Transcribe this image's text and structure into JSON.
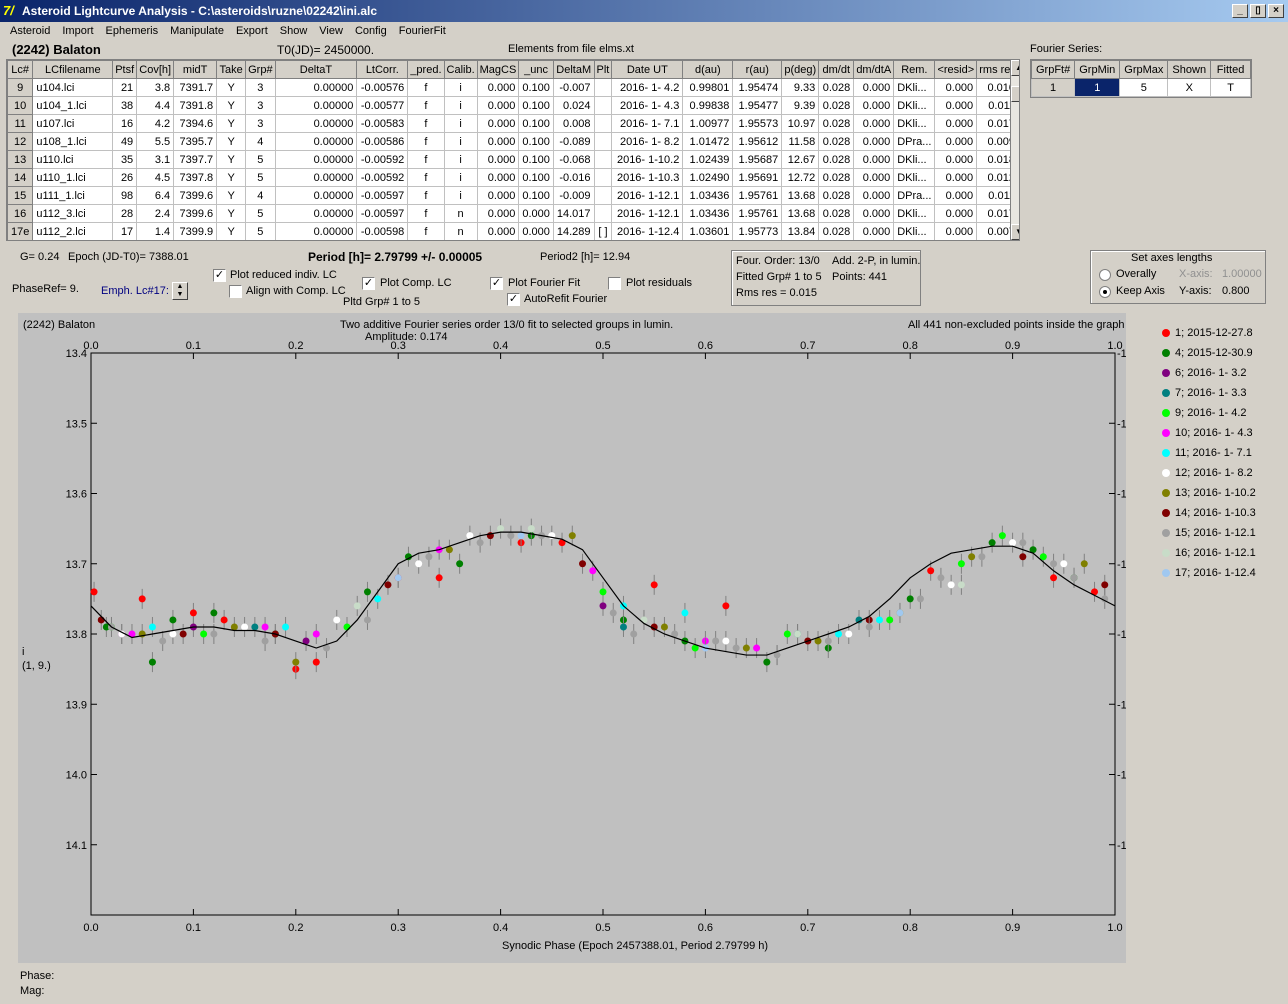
{
  "window": {
    "title": "Asteroid Lightcurve Analysis - C:\\asteroids\\ruzne\\02242\\ini.alc",
    "icon": "7/",
    "min": "_",
    "max": "▯",
    "close": "×"
  },
  "menu": [
    "Asteroid",
    "Import",
    "Ephemeris",
    "Manipulate",
    "Export",
    "Show",
    "View",
    "Config",
    "FourierFit"
  ],
  "header": {
    "asteroid": "(2242) Balaton",
    "t0": "T0(JD)= 2450000.",
    "elements": "Elements from file elms.xt"
  },
  "table": {
    "columns": [
      "Lc#",
      "LCfilename",
      "Ptsf",
      "Cov[h]",
      "midT",
      "Take",
      "Grp#",
      "DeltaT",
      "LtCorr.",
      "_pred.",
      "Calib.",
      "MagCS",
      "_unc",
      "DeltaM",
      "Plt",
      "Date UT",
      "d(au)",
      "r(au)",
      "p(deg)",
      "dm/dt",
      "dm/dtA",
      "Rem.",
      "<resid>",
      "rms res"
    ],
    "rows": [
      [
        "9",
        "u104.lci",
        "21",
        "3.8",
        "7391.7",
        "Y",
        "3",
        "0.00000",
        "-0.00576",
        "f",
        "i",
        "0.000",
        "0.100",
        "-0.007",
        "",
        "2016- 1- 4.2",
        "0.99801",
        "1.95474",
        "9.33",
        "0.028",
        "0.000",
        "DKli...",
        "0.000",
        "0.010"
      ],
      [
        "10",
        "u104_1.lci",
        "38",
        "4.4",
        "7391.8",
        "Y",
        "3",
        "0.00000",
        "-0.00577",
        "f",
        "i",
        "0.000",
        "0.100",
        "0.024",
        "",
        "2016- 1- 4.3",
        "0.99838",
        "1.95477",
        "9.39",
        "0.028",
        "0.000",
        "DKli...",
        "0.000",
        "0.011"
      ],
      [
        "11",
        "u107.lci",
        "16",
        "4.2",
        "7394.6",
        "Y",
        "3",
        "0.00000",
        "-0.00583",
        "f",
        "i",
        "0.000",
        "0.100",
        "0.008",
        "",
        "2016- 1- 7.1",
        "1.00977",
        "1.95573",
        "10.97",
        "0.028",
        "0.000",
        "DKli...",
        "0.000",
        "0.017"
      ],
      [
        "12",
        "u108_1.lci",
        "49",
        "5.5",
        "7395.7",
        "Y",
        "4",
        "0.00000",
        "-0.00586",
        "f",
        "i",
        "0.000",
        "0.100",
        "-0.089",
        "",
        "2016- 1- 8.2",
        "1.01472",
        "1.95612",
        "11.58",
        "0.028",
        "0.000",
        "DPra...",
        "0.000",
        "0.009"
      ],
      [
        "13",
        "u110.lci",
        "35",
        "3.1",
        "7397.7",
        "Y",
        "5",
        "0.00000",
        "-0.00592",
        "f",
        "i",
        "0.000",
        "0.100",
        "-0.068",
        "",
        "2016- 1-10.2",
        "1.02439",
        "1.95687",
        "12.67",
        "0.028",
        "0.000",
        "DKli...",
        "0.000",
        "0.018"
      ],
      [
        "14",
        "u110_1.lci",
        "26",
        "4.5",
        "7397.8",
        "Y",
        "5",
        "0.00000",
        "-0.00592",
        "f",
        "i",
        "0.000",
        "0.100",
        "-0.016",
        "",
        "2016- 1-10.3",
        "1.02490",
        "1.95691",
        "12.72",
        "0.028",
        "0.000",
        "DKli...",
        "0.000",
        "0.012"
      ],
      [
        "15",
        "u111_1.lci",
        "98",
        "6.4",
        "7399.6",
        "Y",
        "4",
        "0.00000",
        "-0.00597",
        "f",
        "i",
        "0.000",
        "0.100",
        "-0.009",
        "",
        "2016- 1-12.1",
        "1.03436",
        "1.95761",
        "13.68",
        "0.028",
        "0.000",
        "DPra...",
        "0.000",
        "0.011"
      ],
      [
        "16",
        "u112_3.lci",
        "28",
        "2.4",
        "7399.6",
        "Y",
        "5",
        "0.00000",
        "-0.00597",
        "f",
        "n",
        "0.000",
        "0.000",
        "14.017",
        "",
        "2016- 1-12.1",
        "1.03436",
        "1.95761",
        "13.68",
        "0.028",
        "0.000",
        "DKli...",
        "0.000",
        "0.017"
      ],
      [
        "17e",
        "u112_2.lci",
        "17",
        "1.4",
        "7399.9",
        "Y",
        "5",
        "0.00000",
        "-0.00598",
        "f",
        "n",
        "0.000",
        "0.000",
        "14.289",
        "[ ]",
        "2016- 1-12.4",
        "1.03601",
        "1.95773",
        "13.84",
        "0.028",
        "0.000",
        "DKli...",
        "0.000",
        "0.007"
      ]
    ]
  },
  "fourier": {
    "label": "Fourier Series:",
    "columns": [
      "GrpFt#",
      "GrpMin",
      "GrpMax",
      "Shown",
      "Fitted"
    ],
    "row": [
      "1",
      "1",
      "5",
      "X",
      "T"
    ]
  },
  "controls": {
    "g": "G= 0.24",
    "epoch": "Epoch (JD-T0)= 7388.01",
    "period": "Period [h]= 2.79799 +/- 0.00005",
    "period2": "Period2 [h]= 12.94",
    "phaseref": "PhaseRef= 9.",
    "emph": "Emph. Lc#17:",
    "plot_reduced": "Plot reduced indiv. LC",
    "align_comp": "Align with Comp. LC",
    "plot_comp": "Plot Comp. LC",
    "pltd_grp": "Pltd Grp#  1   to   5",
    "plot_fourier": "Plot Fourier Fit",
    "autorefit": "AutoRefit Fourier",
    "plot_residuals": "Plot residuals",
    "check": "✓",
    "four_order": "Four. Order: 13/0",
    "add": "Add. 2-P, in lumin.",
    "fitted_grp": "Fitted Grp# 1 to 5",
    "points": "Points: 441",
    "rms": "Rms res     = 0.015",
    "axes_title": "Set axes lengths",
    "overally": "Overally",
    "keep_axis": "Keep Axis",
    "xaxis_lbl": "X-axis:",
    "xaxis_val": "1.00000",
    "yaxis_lbl": "Y-axis:",
    "yaxis_val": "0.800"
  },
  "plot": {
    "asteroid": "(2242) Balaton",
    "title": "Two additive Fourier series order 13/0 fit to selected groups in lumin.",
    "amplitude": "Amplitude: 0.174",
    "note": "All 441 non-excluded points inside the graph",
    "ylabel": "i",
    "ylabel2": "(1, 9.)",
    "xlabel": "Synodic Phase (Epoch 2457388.01, Period 2.79799 h)"
  },
  "chart_data": {
    "type": "scatter",
    "xlabel": "Synodic Phase (Epoch 2457388.01, Period 2.79799 h)",
    "ylabel": "i",
    "xlim": [
      0,
      1
    ],
    "ylim": [
      14.2,
      13.4
    ],
    "y_inverted": true,
    "xticks": [
      "0.0",
      "0.1",
      "0.2",
      "0.3",
      "0.4",
      "0.5",
      "0.6",
      "0.7",
      "0.8",
      "0.9",
      "1.0"
    ],
    "yticks": [
      "13.4",
      "13.5",
      "13.6",
      "13.7",
      "13.8",
      "13.9",
      "14.0",
      "14.1"
    ],
    "fit_curve": {
      "x": [
        0,
        0.02,
        0.04,
        0.06,
        0.08,
        0.1,
        0.12,
        0.14,
        0.16,
        0.18,
        0.2,
        0.22,
        0.24,
        0.26,
        0.28,
        0.3,
        0.32,
        0.34,
        0.36,
        0.38,
        0.4,
        0.42,
        0.44,
        0.46,
        0.48,
        0.5,
        0.52,
        0.54,
        0.56,
        0.58,
        0.6,
        0.62,
        0.64,
        0.66,
        0.68,
        0.7,
        0.72,
        0.74,
        0.76,
        0.78,
        0.8,
        0.82,
        0.84,
        0.86,
        0.88,
        0.9,
        0.92,
        0.94,
        0.96,
        0.98,
        1.0
      ],
      "y": [
        13.76,
        13.79,
        13.805,
        13.8,
        13.795,
        13.79,
        13.79,
        13.795,
        13.795,
        13.8,
        13.81,
        13.82,
        13.81,
        13.78,
        13.74,
        13.7,
        13.685,
        13.68,
        13.67,
        13.66,
        13.655,
        13.655,
        13.66,
        13.665,
        13.68,
        13.72,
        13.76,
        13.785,
        13.8,
        13.81,
        13.82,
        13.825,
        13.83,
        13.83,
        13.82,
        13.81,
        13.8,
        13.79,
        13.775,
        13.75,
        13.72,
        13.7,
        13.685,
        13.68,
        13.675,
        13.675,
        13.685,
        13.71,
        13.73,
        13.745,
        13.76
      ]
    },
    "series": [
      {
        "name": "1; 2015-12-27.8",
        "color": "#ff0000",
        "x": [
          0.003,
          0.05,
          0.1,
          0.13,
          0.2,
          0.22,
          0.3,
          0.34,
          0.42,
          0.46,
          0.55,
          0.62,
          0.82,
          0.94,
          0.98
        ],
        "y": [
          13.74,
          13.75,
          13.77,
          13.78,
          13.85,
          13.84,
          13.72,
          13.72,
          13.67,
          13.67,
          13.73,
          13.76,
          13.71,
          13.72,
          13.74
        ]
      },
      {
        "name": "4; 2015-12-30.9",
        "color": "#008000",
        "x": [
          0.015,
          0.06,
          0.08,
          0.12,
          0.18,
          0.27,
          0.31,
          0.36,
          0.43,
          0.52,
          0.58,
          0.66,
          0.72,
          0.8,
          0.88,
          0.92,
          0.96
        ],
        "y": [
          13.79,
          13.84,
          13.78,
          13.77,
          13.8,
          13.74,
          13.69,
          13.7,
          13.66,
          13.78,
          13.81,
          13.84,
          13.82,
          13.75,
          13.67,
          13.68,
          13.72
        ]
      },
      {
        "name": "6; 2016- 1- 3.2",
        "color": "#800080",
        "x": [
          0.03,
          0.1,
          0.21,
          0.5
        ],
        "y": [
          13.8,
          13.79,
          13.81,
          13.76
        ]
      },
      {
        "name": "7; 2016- 1- 3.3",
        "color": "#008080",
        "x": [
          0.16,
          0.52,
          0.69,
          0.75
        ],
        "y": [
          13.79,
          13.79,
          13.8,
          13.78
        ]
      },
      {
        "name": "9; 2016- 1- 4.2",
        "color": "#00ff00",
        "x": [
          0.02,
          0.11,
          0.25,
          0.5,
          0.59,
          0.68,
          0.78,
          0.85,
          0.89,
          0.93
        ],
        "y": [
          13.79,
          13.8,
          13.79,
          13.74,
          13.82,
          13.8,
          13.78,
          13.7,
          13.66,
          13.69
        ]
      },
      {
        "name": "10; 2016- 1- 4.3",
        "color": "#ff00ff",
        "x": [
          0.04,
          0.17,
          0.22,
          0.34,
          0.49,
          0.6,
          0.65
        ],
        "y": [
          13.8,
          13.79,
          13.8,
          13.68,
          13.71,
          13.81,
          13.82
        ]
      },
      {
        "name": "11; 2016- 1- 7.1",
        "color": "#00ffff",
        "x": [
          0.06,
          0.19,
          0.28,
          0.52,
          0.58,
          0.73,
          0.77
        ],
        "y": [
          13.79,
          13.79,
          13.75,
          13.76,
          13.77,
          13.8,
          13.78
        ]
      },
      {
        "name": "12; 2016- 1- 8.2",
        "color": "#ffffff",
        "x": [
          0.03,
          0.08,
          0.15,
          0.24,
          0.32,
          0.37,
          0.45,
          0.62,
          0.67,
          0.74,
          0.84,
          0.9,
          0.95
        ],
        "y": [
          13.8,
          13.8,
          13.79,
          13.78,
          13.7,
          13.66,
          13.66,
          13.81,
          13.83,
          13.8,
          13.73,
          13.67,
          13.7
        ]
      },
      {
        "name": "13; 2016- 1-10.2",
        "color": "#808000",
        "x": [
          0.05,
          0.14,
          0.2,
          0.35,
          0.47,
          0.56,
          0.64,
          0.71,
          0.79,
          0.86,
          0.97
        ],
        "y": [
          13.8,
          13.79,
          13.84,
          13.68,
          13.66,
          13.79,
          13.82,
          13.81,
          13.77,
          13.69,
          13.7
        ]
      },
      {
        "name": "14; 2016- 1-10.3",
        "color": "#800000",
        "x": [
          0.01,
          0.09,
          0.18,
          0.29,
          0.39,
          0.48,
          0.55,
          0.7,
          0.76,
          0.91,
          0.99
        ],
        "y": [
          13.78,
          13.8,
          13.8,
          13.73,
          13.66,
          13.7,
          13.79,
          13.81,
          13.78,
          13.69,
          13.73
        ]
      },
      {
        "name": "15; 2016- 1-12.1",
        "color": "#a0a0a0",
        "x": [
          0.02,
          0.07,
          0.12,
          0.17,
          0.23,
          0.27,
          0.33,
          0.38,
          0.41,
          0.44,
          0.51,
          0.53,
          0.57,
          0.61,
          0.63,
          0.67,
          0.72,
          0.76,
          0.81,
          0.83,
          0.87,
          0.91,
          0.94,
          0.96,
          0.99
        ],
        "y": [
          13.79,
          13.81,
          13.8,
          13.81,
          13.82,
          13.78,
          13.69,
          13.67,
          13.66,
          13.66,
          13.77,
          13.8,
          13.8,
          13.81,
          13.82,
          13.83,
          13.81,
          13.79,
          13.75,
          13.72,
          13.69,
          13.67,
          13.7,
          13.72,
          13.75
        ]
      },
      {
        "name": "16; 2016- 1-12.1",
        "color": "#c8dcc8",
        "x": [
          0.26,
          0.4,
          0.43,
          0.54,
          0.69,
          0.85
        ],
        "y": [
          13.76,
          13.65,
          13.65,
          13.78,
          13.8,
          13.73
        ]
      },
      {
        "name": "17; 2016- 1-12.4",
        "color": "#a0c8f0",
        "x": [
          0.3,
          0.42,
          0.6,
          0.79
        ],
        "y": [
          13.72,
          13.66,
          13.82,
          13.77
        ]
      }
    ]
  }
}
